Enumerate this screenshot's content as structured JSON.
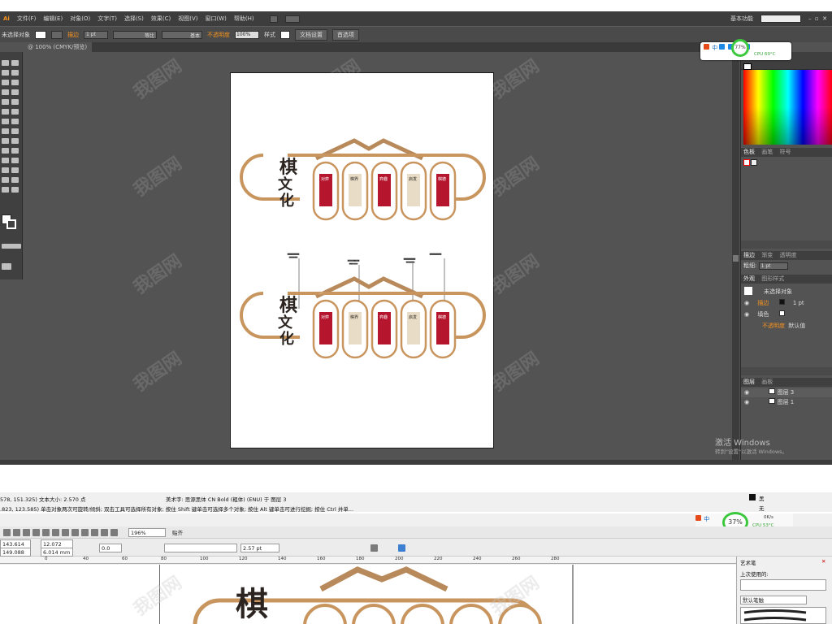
{
  "illustrator": {
    "menu": [
      "文件(F)",
      "编辑(E)",
      "对象(O)",
      "文字(T)",
      "选择(S)",
      "效果(C)",
      "视图(V)",
      "窗口(W)",
      "帮助(H)"
    ],
    "workspace_label": "基本功能",
    "control": {
      "selection_status": "未选择对象",
      "stroke_label": "描边",
      "stroke_weight": "1 pt",
      "stroke_profile": "等比",
      "brush_label": "基本",
      "opacity_label": "不透明度",
      "opacity_value": "100%",
      "style_label": "样式",
      "doc_setup_btn": "文档设置",
      "preferences_btn": "首选项"
    },
    "doc_tab": "@ 100% (CMYK/预览)",
    "tray": {
      "percent": "77%",
      "cpu": "CPU 69°C",
      "ime": "中"
    },
    "right_panel": {
      "color_tabs": [
        "色板",
        "画笔",
        "符号"
      ],
      "stroke_tabs": [
        "描边",
        "渐变",
        "透明度"
      ],
      "weight_label": "粗细:",
      "weight_value": "1 pt",
      "appearance_tabs": [
        "外观",
        "图形样式"
      ],
      "appearance_title": "未选择对象",
      "stroke_row": "描边",
      "stroke_row_value": "1 pt",
      "fill_row": "填色",
      "opacity_row": "不透明度",
      "opacity_row_value": "默认值",
      "layers_tabs": [
        "图层",
        "画板"
      ],
      "layers": [
        "图层 3",
        "图层 1"
      ]
    },
    "activation": {
      "title": "激活 Windows",
      "subtitle": "转到\"设置\"以激活 Windows。"
    }
  },
  "artwork": {
    "title_chars": [
      "棋",
      "文",
      "化"
    ],
    "panels_top": [
      "对弈",
      "棋界",
      "弈趣",
      "启发",
      "棋德"
    ],
    "panels_bottom": [
      "对弈",
      "棋界",
      "弈趣",
      "启发",
      "棋德"
    ],
    "colors": {
      "frame": "#c9955e",
      "panel": "#b5162e",
      "roof": "#b8895a",
      "text": "#2b2420"
    }
  },
  "coreldraw": {
    "status_line1": "578, 151.325)  文本大小: 2.570  点",
    "font_info": "美术字: 思源黑体 CN Bold (粗体) (ENU) 于 图层 3",
    "status_line2": ".823, 123.585)    单击对象两次可旋转/倾斜; 双击工具可选择所有对象; 按住 Shift 键单击可选择多个对象; 按住 Alt 键单击可进行挖掘; 按住 Ctrl 并单...",
    "fill_label": "黑",
    "outline_label": "无",
    "zoom": "196%",
    "snap": "贴齐",
    "x_size": "143.614 mm",
    "y_size": "149.088 mm",
    "w_size": "12.072 mm",
    "h_size": "6.014 mm",
    "rotation": "0.0",
    "outline_width": "2.57 pt",
    "tray": {
      "percent": "37%",
      "cpu": "CPU 53°C",
      "speed": "0K/s",
      "ime": "中"
    },
    "ruler": [
      "0",
      "20",
      "40",
      "60",
      "80",
      "100",
      "120",
      "140",
      "160",
      "180",
      "200",
      "220",
      "240",
      "260",
      "280"
    ],
    "docker_title": "艺术笔",
    "recently_used": "上次使用的:",
    "default_brush": "默认笔触"
  },
  "watermark": "我图网"
}
